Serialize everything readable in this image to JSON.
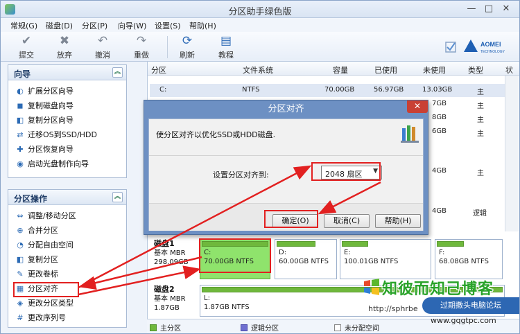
{
  "window": {
    "title": "分区助手绿色版"
  },
  "menu": [
    "常规(G)",
    "磁盘(D)",
    "分区(P)",
    "向导(W)",
    "设置(S)",
    "帮助(H)"
  ],
  "toolbar": {
    "submit": "提交",
    "discard": "放弃",
    "undo": "撤消",
    "redo": "重做",
    "refresh": "刷新",
    "tutorial": "教程"
  },
  "logo": {
    "brand": "AOMEI",
    "sub": "TECHNOLOGY"
  },
  "wizard_panel": {
    "title": "向导",
    "items": [
      "扩展分区向导",
      "复制磁盘向导",
      "复制分区向导",
      "迁移OS到SSD/HDD",
      "分区恢复向导",
      "启动光盘制作向导"
    ]
  },
  "ops_panel": {
    "title": "分区操作",
    "items": [
      "调整/移动分区",
      "合并分区",
      "分配自由空间",
      "复制分区",
      "更改卷标",
      "分区对齐",
      "更改分区类型",
      "更改序列号"
    ]
  },
  "table": {
    "headers": [
      "分区",
      "文件系统",
      "容量",
      "已使用",
      "未使用",
      "类型",
      "状"
    ],
    "rows": [
      {
        "part": "C:",
        "fs": "NTFS",
        "cap": "70.00GB",
        "used": "56.97GB",
        "free": "13.03GB",
        "type": "主"
      },
      {
        "part": "",
        "fs": "",
        "cap": "",
        "used": "",
        "free": "7GB",
        "type": "主"
      },
      {
        "part": "",
        "fs": "",
        "cap": "",
        "used": "",
        "free": "8GB",
        "type": "主"
      },
      {
        "part": "",
        "fs": "",
        "cap": "",
        "used": "",
        "free": "6GB",
        "type": "主"
      },
      {
        "part": "",
        "fs": "",
        "cap": "",
        "used": "",
        "free": "4GB",
        "type": "主"
      },
      {
        "part": "",
        "fs": "",
        "cap": "",
        "used": "",
        "free": "4GB",
        "type": "逻辑"
      }
    ]
  },
  "dialog": {
    "title": "分区对齐",
    "close": "✕",
    "description": "使分区对齐以优化SSD或HDD磁盘.",
    "label": "设置分区对齐到:",
    "selected": "2048 扇区",
    "ok": "确定(O)",
    "cancel": "取消(C)",
    "help": "帮助(H)"
  },
  "disk1": {
    "name": "磁盘1",
    "kind": "基本 MBR",
    "size": "298.09GB",
    "partitions": [
      {
        "label": "C:",
        "detail": "70.00GB NTFS"
      },
      {
        "label": "D:",
        "detail": "60.00GB NTFS"
      },
      {
        "label": "E:",
        "detail": "100.01GB NTFS"
      },
      {
        "label": "F:",
        "detail": "68.08GB NTFS"
      }
    ]
  },
  "disk2": {
    "name": "磁盘2",
    "kind": "基本 MBR",
    "size": "1.87GB",
    "partitions": [
      {
        "label": "L:",
        "detail": "1.87GB NTFS"
      }
    ]
  },
  "legend": {
    "primary": "主分区",
    "logical": "逻辑分区",
    "unallocated": "未分配空间"
  },
  "watermark": {
    "big": "知彼而知己博客",
    "url": "http://sphrbe",
    "forum": "过期撒头电脑论坛",
    "site": "www.gqgtpc.com"
  },
  "colors": {
    "primary": "#6fb83c",
    "logical": "#6f6fd0",
    "highlight": "#e22020",
    "dialog_frame": "#6d90c3"
  }
}
